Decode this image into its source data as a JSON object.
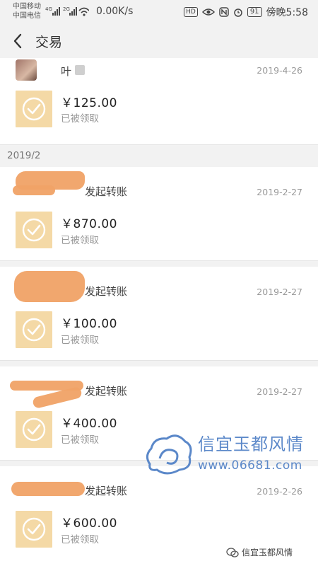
{
  "status_bar": {
    "carrier_1": "中国移动",
    "carrier_2": "中国电信",
    "speed": "0.00K/s",
    "battery": "91",
    "time": "傍晚5:58",
    "hd": "HD"
  },
  "nav": {
    "title": "交易"
  },
  "transactions": [
    {
      "name": "叶",
      "date": "2019-4-26",
      "amount": "￥125.00",
      "status": "已被领取"
    },
    {
      "name": "发起转账",
      "date": "2019-2-27",
      "amount": "￥870.00",
      "status": "已被领取"
    },
    {
      "name": "发起转账",
      "date": "2019-2-27",
      "amount": "￥100.00",
      "status": "已被领取"
    },
    {
      "name": "发起转账",
      "date": "2019-2-27",
      "amount": "￥400.00",
      "status": "已被领取"
    },
    {
      "name": "发起转账",
      "date": "2019-2-26",
      "amount": "￥600.00",
      "status": "已被领取"
    }
  ],
  "month_header": "2019/2",
  "watermark": {
    "title": "信宜玉都风情",
    "url": "www.06681.com",
    "footer": "信宜玉都风情"
  },
  "colors": {
    "tile": "#f4d9a6",
    "redaction": "#f0a266",
    "watermark": "#5b88c9"
  }
}
